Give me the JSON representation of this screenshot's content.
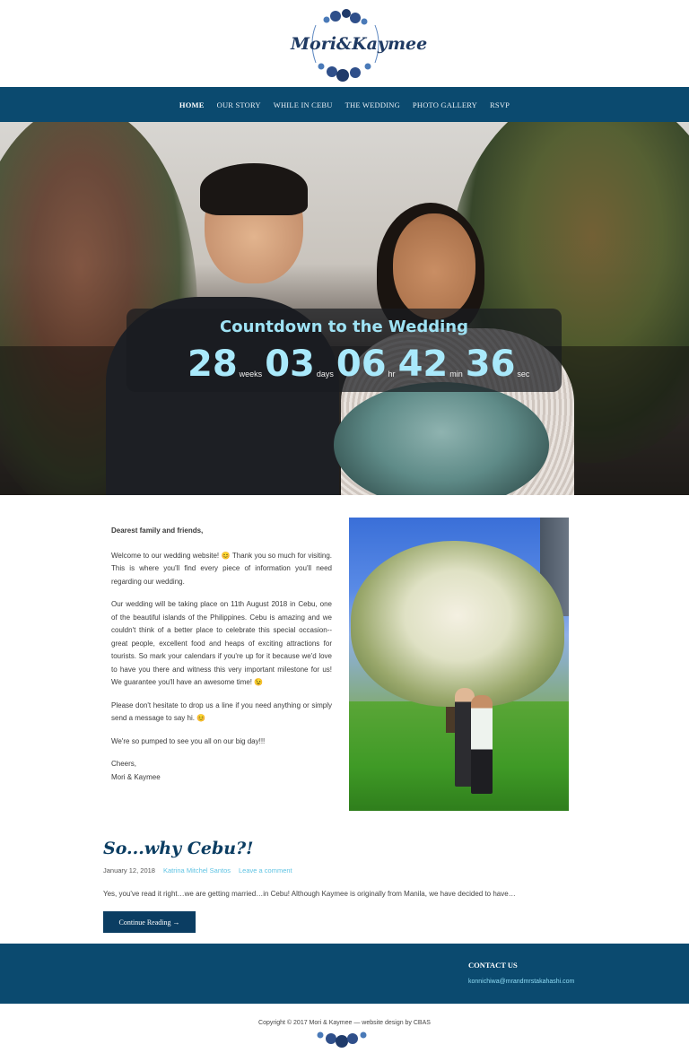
{
  "site": {
    "logo_text": "Mori&Kaymee"
  },
  "nav": {
    "items": [
      "HOME",
      "OUR STORY",
      "WHILE IN CEBU",
      "THE WEDDING",
      "PHOTO GALLERY",
      "RSVP"
    ]
  },
  "countdown": {
    "title": "Countdown to the Wedding",
    "weeks": "28",
    "weeks_label": "weeks",
    "days": "03",
    "days_label": "days",
    "hours": "06",
    "hours_label": "hr",
    "minutes": "42",
    "minutes_label": "min",
    "seconds": "36",
    "seconds_label": "sec"
  },
  "intro": {
    "greeting": "Dearest family and friends,",
    "p1": "Welcome to our wedding website! 😊 Thank you so much for visiting. This is where you'll find every piece of information you'll need regarding our wedding.",
    "p2": "Our wedding will be taking place on 11th August 2018 in Cebu, one of the beautiful islands of the Philippines. Cebu is amazing and we couldn't think of a better place to celebrate this special occasion--great people, excellent food and heaps of exciting attractions for tourists. So mark your calendars if you're up for it because we'd love to have you there and witness this very important milestone for us! We guarantee you'll have an awesome time! 😉",
    "p3": "Please don't hesitate to drop us a line if you need anything or simply send a message to say hi. 😊",
    "p4": "We're so pumped to see you all on our big day!!!",
    "sign_1": "Cheers,",
    "sign_2": "Mori & Kaymee"
  },
  "post": {
    "title": "So...why Cebu?!",
    "date": "January 12, 2018",
    "author": "Katrina Mitchel Santos",
    "comment_link": "Leave a comment",
    "excerpt": "Yes, you've read it right…we are getting married…in Cebu! Although Kaymee is originally from Manila, we have decided to have…",
    "button": "Continue Reading →"
  },
  "footer": {
    "heading": "CONTACT US",
    "email": "konnichiwa@mrandmrstakahashi.com",
    "copyright": "Copyright © 2017 Mori & Kaymee — website design by CBAS"
  },
  "colors": {
    "nav_bg": "#0b4a6f",
    "accent_cyan": "#a9e9fb",
    "title_navy": "#0b3d62",
    "link": "#5fc3e3"
  }
}
